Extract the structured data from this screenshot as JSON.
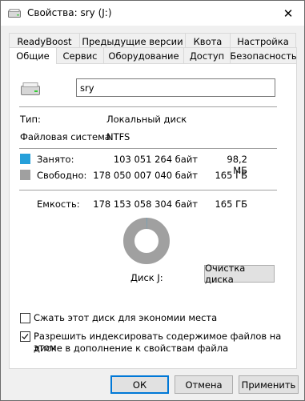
{
  "window": {
    "title": "Свойства: sry (J:)",
    "close_glyph": "✕"
  },
  "tabs_top": [
    "ReadyBoost",
    "Предыдущие версии",
    "Квота",
    "Настройка"
  ],
  "tabs_bottom": [
    "Общие",
    "Сервис",
    "Оборудование",
    "Доступ",
    "Безопасность"
  ],
  "active_tab": "Общие",
  "general": {
    "name_value": "sry",
    "type_label": "Тип:",
    "type_value": "Локальный диск",
    "fs_label": "Файловая система:",
    "fs_value": "NTFS",
    "used_label": "Занято:",
    "used_bytes": "103 051 264 байт",
    "used_size": "98,2 МБ",
    "used_color": "#26a0da",
    "free_label": "Свободно:",
    "free_bytes": "178 050 007 040 байт",
    "free_size": "165 ГБ",
    "free_color": "#a0a0a0",
    "capacity_label": "Емкость:",
    "capacity_bytes": "178 153 058 304 байт",
    "capacity_size": "165 ГБ",
    "disk_label": "Диск J:",
    "cleanup_button": "Очистка диска",
    "used_fraction": 0.0006
  },
  "options": {
    "compress_label": "Сжать этот диск для экономии места",
    "compress_checked": false,
    "index_label_line1": "Разрешить индексировать содержимое файлов на этом",
    "index_label_line2": "диске в дополнение к свойствам файла",
    "index_checked": true
  },
  "footer": {
    "ok": "ОК",
    "cancel": "Отмена",
    "apply": "Применить"
  }
}
